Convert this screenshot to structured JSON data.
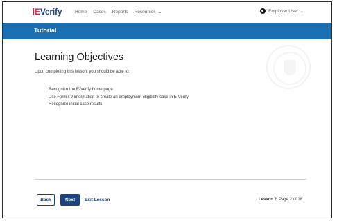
{
  "brand": {
    "e_letter": "E",
    "rest": "Verify"
  },
  "nav": {
    "links": [
      "Home",
      "Cases",
      "Reports",
      "Resources"
    ],
    "chevron": "⌄"
  },
  "user": {
    "label": "Employer User",
    "icon": "user-circle-icon"
  },
  "banner": {
    "title": "Tutorial",
    "color": "#1a6fb3"
  },
  "content": {
    "heading": "Learning Objectives",
    "intro": "Upon completing this lesson, you should be able to:",
    "objectives": [
      "Recognize the E-Verify home page",
      "Use Form I-9 information to create an employment eligibility case in E-Verify",
      "Recognize initial case results"
    ]
  },
  "footer": {
    "back_label": "Back",
    "next_label": "Next",
    "exit_label": "Exit Lesson",
    "lesson_label": "Lesson 2",
    "page_label": "Page 2 of 18"
  },
  "colors": {
    "primary": "#1a4480",
    "brand_red": "#e31c3d"
  }
}
